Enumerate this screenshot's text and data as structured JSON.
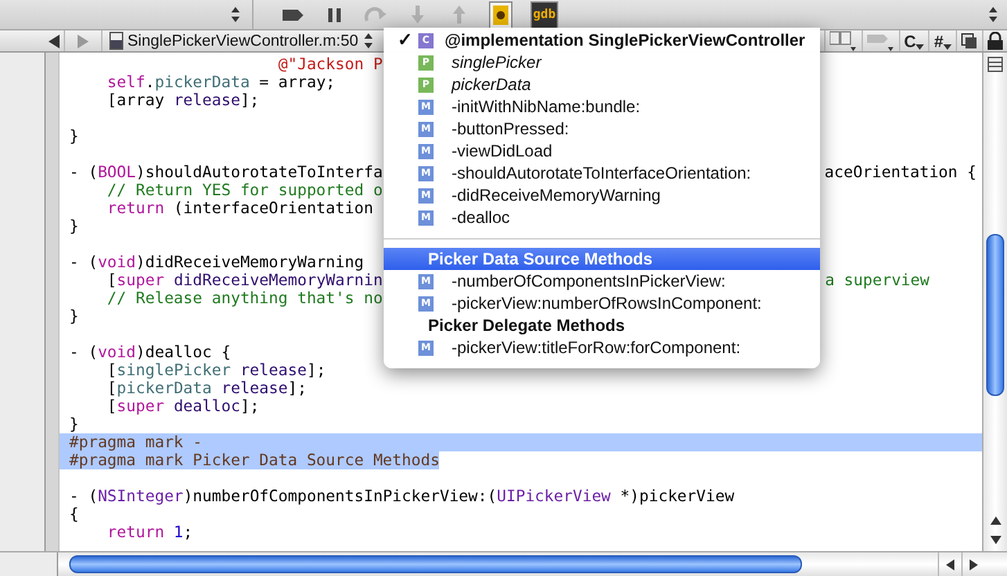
{
  "toolbar": {
    "buttons": [
      {
        "kind": "breakpoints",
        "disabled": false
      },
      {
        "kind": "pause",
        "disabled": false
      },
      {
        "kind": "step_over",
        "disabled": true
      },
      {
        "kind": "step_into",
        "disabled": true
      },
      {
        "kind": "step_out",
        "disabled": true
      },
      {
        "kind": "debugger",
        "disabled": false
      },
      {
        "kind": "console",
        "label": "gdb",
        "disabled": false
      }
    ]
  },
  "navbar": {
    "file": "SinglePickerViewController.m:50",
    "items": [
      {
        "kind": "bookmarks"
      },
      {
        "kind": "breakpoints"
      },
      {
        "kind": "classes",
        "label": "C"
      },
      {
        "kind": "includes",
        "label": "#"
      },
      {
        "kind": "counterpart"
      },
      {
        "kind": "lock"
      }
    ]
  },
  "editor": {
    "lines": [
      {
        "kind": "code",
        "tokens": [
          {
            "kind": "string",
            "text": "                      @\"Jackson P"
          }
        ]
      },
      {
        "kind": "code",
        "tokens": [
          {
            "kind": "keyword",
            "text": "    self"
          },
          {
            "kind": "plain",
            "text": "."
          },
          {
            "kind": "ident",
            "text": "pickerData"
          },
          {
            "kind": "plain",
            "text": " = array;"
          }
        ]
      },
      {
        "kind": "code",
        "tokens": [
          {
            "kind": "plain",
            "text": "    [array "
          },
          {
            "kind": "method",
            "text": "release"
          },
          {
            "kind": "plain",
            "text": "];"
          }
        ]
      },
      {
        "kind": "blank"
      },
      {
        "kind": "code",
        "tokens": [
          {
            "kind": "plain",
            "text": "}"
          }
        ]
      },
      {
        "kind": "blank"
      },
      {
        "kind": "code",
        "tokens": [
          {
            "kind": "plain",
            "text": "- ("
          },
          {
            "kind": "keyword",
            "text": "BOOL"
          },
          {
            "kind": "plain",
            "text": ")shouldAutorotateToInterfa"
          }
        ],
        "tail": [
          {
            "kind": "plain",
            "text": "aceOrientation {"
          }
        ]
      },
      {
        "kind": "code",
        "tokens": [
          {
            "kind": "comment",
            "text": "    // Return YES for supported o"
          }
        ]
      },
      {
        "kind": "code",
        "tokens": [
          {
            "kind": "keyword",
            "text": "    return"
          },
          {
            "kind": "plain",
            "text": " (interfaceOrientation"
          }
        ]
      },
      {
        "kind": "code",
        "tokens": [
          {
            "kind": "plain",
            "text": "}"
          }
        ]
      },
      {
        "kind": "blank"
      },
      {
        "kind": "code",
        "tokens": [
          {
            "kind": "plain",
            "text": "- ("
          },
          {
            "kind": "keyword",
            "text": "void"
          },
          {
            "kind": "plain",
            "text": ")didReceiveMemoryWarning"
          }
        ]
      },
      {
        "kind": "code",
        "tokens": [
          {
            "kind": "plain",
            "text": "    ["
          },
          {
            "kind": "keyword",
            "text": "super"
          },
          {
            "kind": "method",
            "text": " didReceiveMemoryWarnin"
          }
        ],
        "tail": [
          {
            "kind": "comment",
            "text": "a superview"
          }
        ]
      },
      {
        "kind": "code",
        "tokens": [
          {
            "kind": "comment",
            "text": "    // Release anything that's no"
          }
        ]
      },
      {
        "kind": "code",
        "tokens": [
          {
            "kind": "plain",
            "text": "}"
          }
        ]
      },
      {
        "kind": "blank"
      },
      {
        "kind": "code",
        "tokens": [
          {
            "kind": "plain",
            "text": "- ("
          },
          {
            "kind": "keyword",
            "text": "void"
          },
          {
            "kind": "plain",
            "text": ")dealloc {"
          }
        ]
      },
      {
        "kind": "code",
        "tokens": [
          {
            "kind": "plain",
            "text": "    ["
          },
          {
            "kind": "ident",
            "text": "singlePicker"
          },
          {
            "kind": "method",
            "text": " release"
          },
          {
            "kind": "plain",
            "text": "];"
          }
        ]
      },
      {
        "kind": "code",
        "tokens": [
          {
            "kind": "plain",
            "text": "    ["
          },
          {
            "kind": "ident",
            "text": "pickerData"
          },
          {
            "kind": "method",
            "text": " release"
          },
          {
            "kind": "plain",
            "text": "];"
          }
        ]
      },
      {
        "kind": "code",
        "tokens": [
          {
            "kind": "plain",
            "text": "    ["
          },
          {
            "kind": "keyword",
            "text": "super"
          },
          {
            "kind": "method",
            "text": " dealloc"
          },
          {
            "kind": "plain",
            "text": "];"
          }
        ]
      },
      {
        "kind": "code",
        "tokens": [
          {
            "kind": "plain",
            "text": "}"
          }
        ]
      },
      {
        "kind": "code",
        "selected": true,
        "tokens": [
          {
            "kind": "pragma",
            "text": "#pragma mark -"
          }
        ]
      },
      {
        "kind": "code",
        "selected": true,
        "tokens": [
          {
            "kind": "pragma",
            "text": "#pragma mark Picker Data Source Methods"
          }
        ]
      },
      {
        "kind": "blank"
      },
      {
        "kind": "code",
        "tokens": [
          {
            "kind": "plain",
            "text": "- ("
          },
          {
            "kind": "type",
            "text": "NSInteger"
          },
          {
            "kind": "plain",
            "text": ")numberOfComponentsInPickerView:("
          },
          {
            "kind": "type",
            "text": "UIPickerView"
          },
          {
            "kind": "plain",
            "text": " *)pickerView"
          }
        ]
      },
      {
        "kind": "code",
        "tokens": [
          {
            "kind": "plain",
            "text": "{"
          }
        ]
      },
      {
        "kind": "code",
        "tokens": [
          {
            "kind": "keyword",
            "text": "    return"
          },
          {
            "kind": "number",
            "text": " 1"
          },
          {
            "kind": "plain",
            "text": ";"
          }
        ]
      }
    ]
  },
  "popup": {
    "check_symbol": "✓",
    "items": [
      {
        "kind": "implementation",
        "badge": "C",
        "label": "@implementation SinglePickerViewController",
        "checked": true,
        "selected": false
      },
      {
        "kind": "property",
        "badge": "P",
        "label": "singlePicker",
        "checked": false,
        "selected": false
      },
      {
        "kind": "property",
        "badge": "P",
        "label": "pickerData",
        "checked": false,
        "selected": false
      },
      {
        "kind": "method",
        "badge": "M",
        "label": "-initWithNibName:bundle:",
        "checked": false,
        "selected": false
      },
      {
        "kind": "method",
        "badge": "M",
        "label": "-buttonPressed:",
        "checked": false,
        "selected": false
      },
      {
        "kind": "method",
        "badge": "M",
        "label": "-viewDidLoad",
        "checked": false,
        "selected": false
      },
      {
        "kind": "method",
        "badge": "M",
        "label": "-shouldAutorotateToInterfaceOrientation:",
        "checked": false,
        "selected": false
      },
      {
        "kind": "method",
        "badge": "M",
        "label": "-didReceiveMemoryWarning",
        "checked": false,
        "selected": false
      },
      {
        "kind": "method",
        "badge": "M",
        "label": "-dealloc",
        "checked": false,
        "selected": false
      },
      {
        "kind": "separator"
      },
      {
        "kind": "mark",
        "label": "Picker Data Source Methods",
        "checked": false,
        "selected": true
      },
      {
        "kind": "method",
        "badge": "M",
        "label": "-numberOfComponentsInPickerView:",
        "checked": false,
        "selected": false
      },
      {
        "kind": "method",
        "badge": "M",
        "label": "-pickerView:numberOfRowsInComponent:",
        "checked": false,
        "selected": false
      },
      {
        "kind": "mark",
        "label": "Picker Delegate Methods",
        "checked": false,
        "selected": false
      },
      {
        "kind": "method",
        "badge": "M",
        "label": "-pickerView:titleForRow:forComponent:",
        "checked": false,
        "selected": false
      }
    ]
  }
}
